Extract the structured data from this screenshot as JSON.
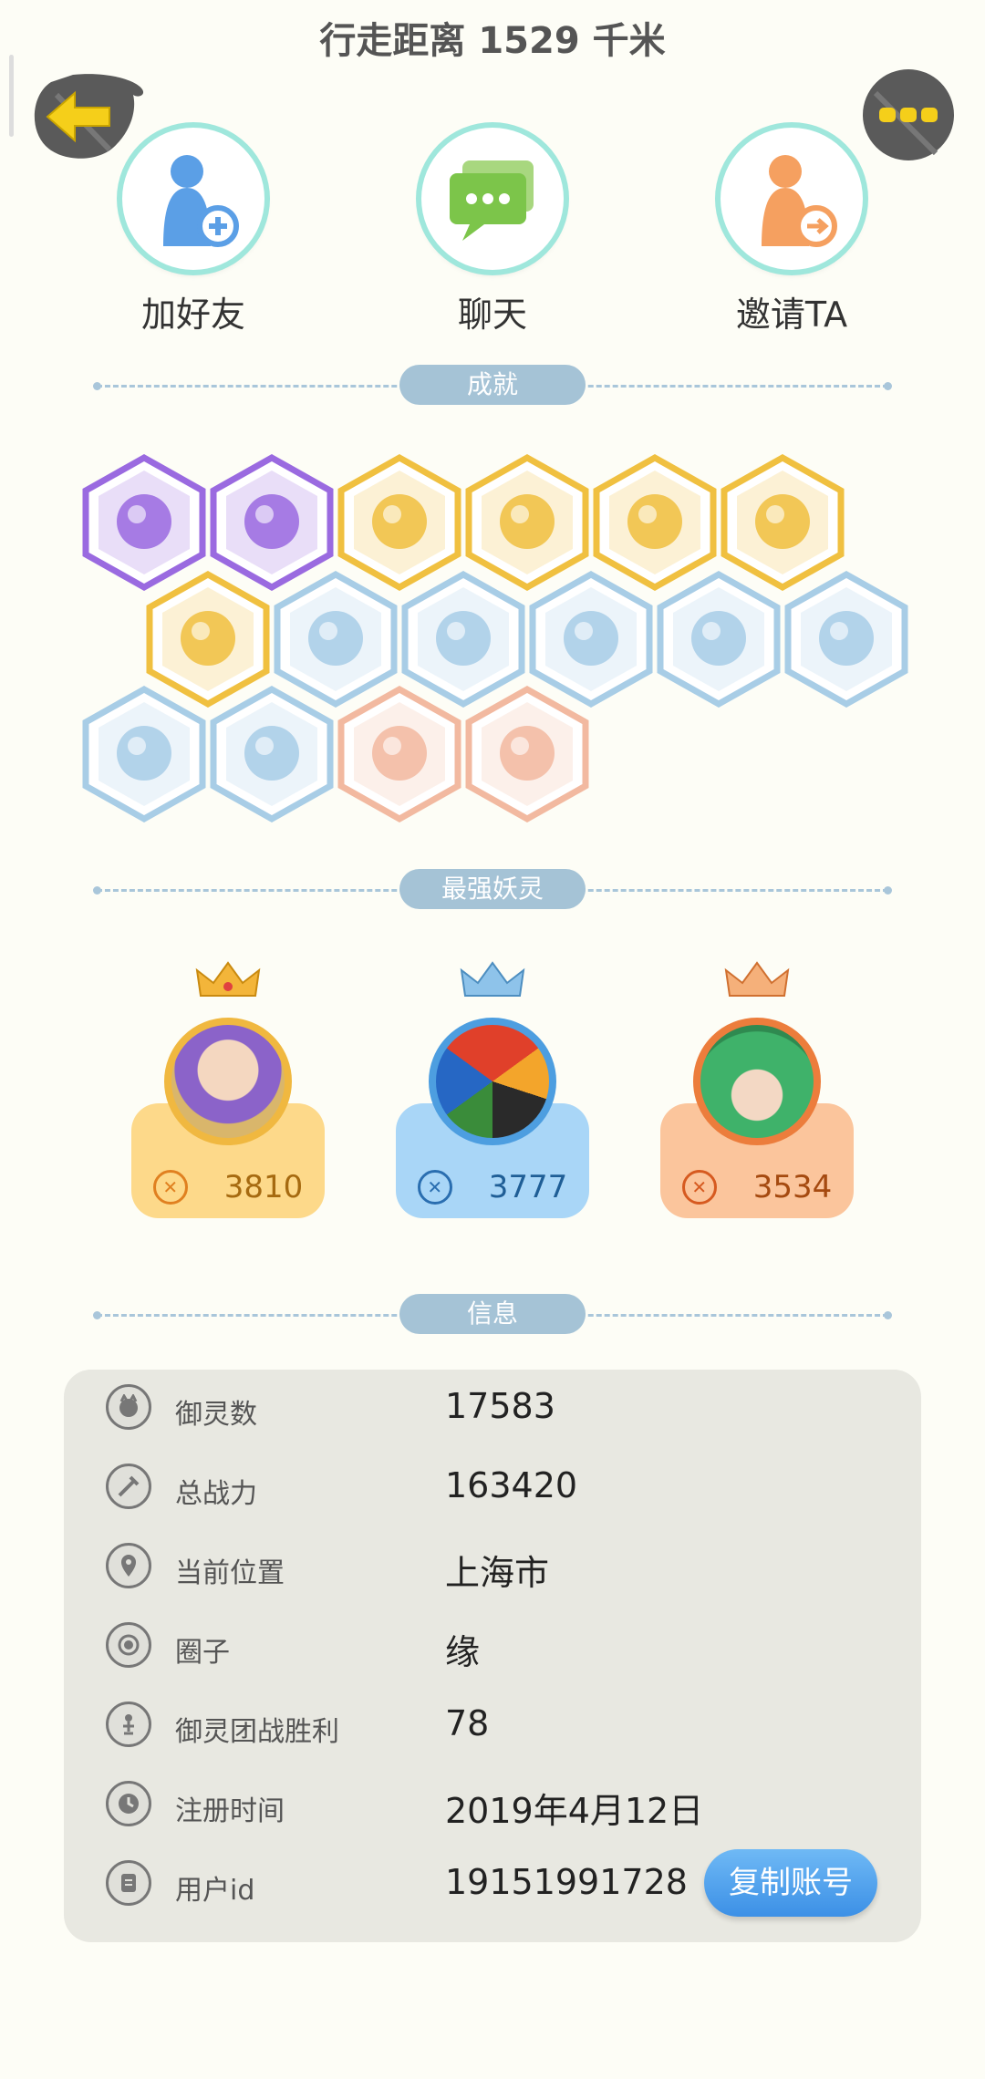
{
  "header": {
    "title": "行走距离 1529 千米"
  },
  "actions": [
    {
      "label": "加好友",
      "icon": "add-friend-icon",
      "color": "#5b9fe6"
    },
    {
      "label": "聊天",
      "icon": "chat-icon",
      "color": "#7cc54a"
    },
    {
      "label": "邀请TA",
      "icon": "invite-icon",
      "color": "#f5a060"
    }
  ],
  "sections": {
    "achievements": "成就",
    "strongest": "最强妖灵",
    "info": "信息"
  },
  "badge_colors": {
    "purple": "#9a6ae0",
    "gold": "#f0c040",
    "blue": "#a8cde6",
    "peach": "#f2b9a0"
  },
  "strongest": [
    {
      "power": "3810",
      "card": "#fdd98a",
      "ring": "#f0b840",
      "text": "#a66a10"
    },
    {
      "power": "3777",
      "card": "#a9d6f7",
      "ring": "#4d9ee0",
      "text": "#1f5e96"
    },
    {
      "power": "3534",
      "card": "#fbc59c",
      "ring": "#ec7d3c",
      "text": "#a54a10"
    }
  ],
  "info": {
    "rows": [
      {
        "key": "御灵数",
        "value": "17583",
        "icon": "spirit-count-icon"
      },
      {
        "key": "总战力",
        "value": "163420",
        "icon": "sword-icon"
      },
      {
        "key": "当前位置",
        "value": "上海市",
        "icon": "location-pin-icon"
      },
      {
        "key": "圈子",
        "value": "缘",
        "icon": "circle-icon"
      },
      {
        "key": "御灵团战胜利",
        "value": "78",
        "icon": "trophy-icon"
      },
      {
        "key": "注册时间",
        "value": "2019年4月12日",
        "icon": "clock-icon"
      },
      {
        "key": "用户id",
        "value": "19151991728",
        "icon": "id-card-icon"
      }
    ],
    "copy_button": "复制账号"
  }
}
